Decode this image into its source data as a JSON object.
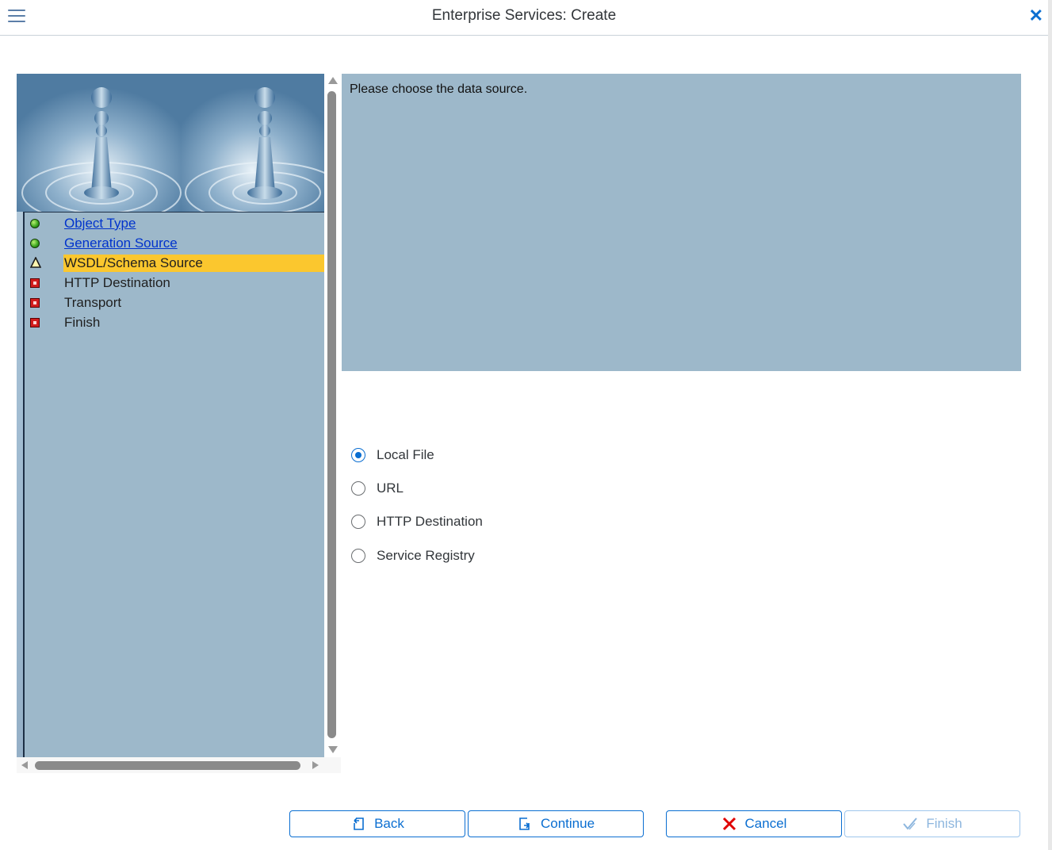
{
  "window": {
    "title": "Enterprise Services: Create"
  },
  "steps": [
    {
      "label": "Object Type",
      "status": "completed",
      "icon": "green-dot-icon"
    },
    {
      "label": "Generation Source",
      "status": "completed",
      "icon": "green-dot-icon"
    },
    {
      "label": "WSDL/Schema Source",
      "status": "current",
      "icon": "warning-triangle-icon"
    },
    {
      "label": "HTTP Destination",
      "status": "pending",
      "icon": "red-square-icon"
    },
    {
      "label": "Transport",
      "status": "pending",
      "icon": "red-square-icon"
    },
    {
      "label": "Finish",
      "status": "pending",
      "icon": "red-square-icon"
    }
  ],
  "info": {
    "text": "Please choose the data source."
  },
  "options": [
    {
      "label": "Local File",
      "selected": true
    },
    {
      "label": "URL",
      "selected": false
    },
    {
      "label": "HTTP Destination",
      "selected": false
    },
    {
      "label": "Service Registry",
      "selected": false
    }
  ],
  "buttons": {
    "back": "Back",
    "continue": "Continue",
    "cancel": "Cancel",
    "finish": "Finish"
  },
  "colors": {
    "accent": "#0a6ed1",
    "panel": "#9db8ca",
    "highlight": "#fbc72e",
    "cancel_icon": "#e00000"
  }
}
